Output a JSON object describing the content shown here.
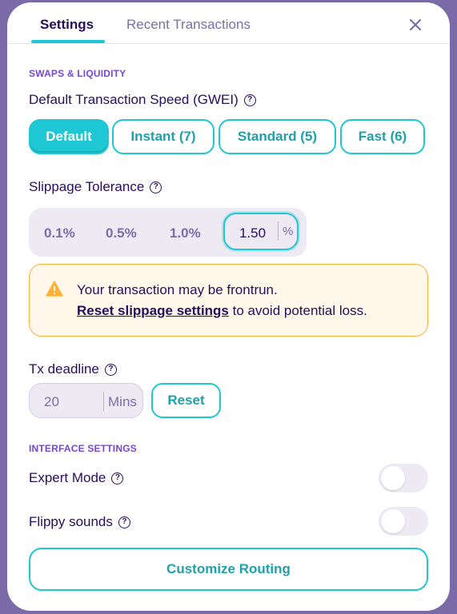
{
  "tabs": {
    "settings": "Settings",
    "recent": "Recent Transactions"
  },
  "swaps": {
    "section_label": "SWAPS & LIQUIDITY",
    "speed_title": "Default Transaction Speed (GWEI)",
    "speed_options": [
      "Default",
      "Instant (7)",
      "Standard (5)",
      "Fast (6)"
    ],
    "speed_selected": "Default",
    "slippage_title": "Slippage Tolerance",
    "slippage_options": [
      "0.1%",
      "0.5%",
      "1.0%"
    ],
    "slippage_value": "1.50",
    "slippage_unit": "%",
    "warning_line1": "Your transaction may be frontrun.",
    "warning_link": "Reset slippage settings",
    "warning_rest": " to avoid potential loss.",
    "deadline_title": "Tx deadline",
    "deadline_value": "20",
    "deadline_unit": "Mins",
    "reset_label": "Reset"
  },
  "interface": {
    "section_label": "INTERFACE SETTINGS",
    "expert_mode_label": "Expert Mode",
    "expert_mode_on": false,
    "flippy_label": "Flippy sounds",
    "flippy_on": false
  },
  "routing_button": "Customize Routing",
  "colors": {
    "primary": "#1fc7d4",
    "text": "#280d5f",
    "secondary": "#7645d9",
    "warning": "#ffb237",
    "background": "#7b6aa8"
  },
  "icons": {
    "close": "close-icon",
    "help": "help-icon",
    "warning": "warning-icon"
  }
}
